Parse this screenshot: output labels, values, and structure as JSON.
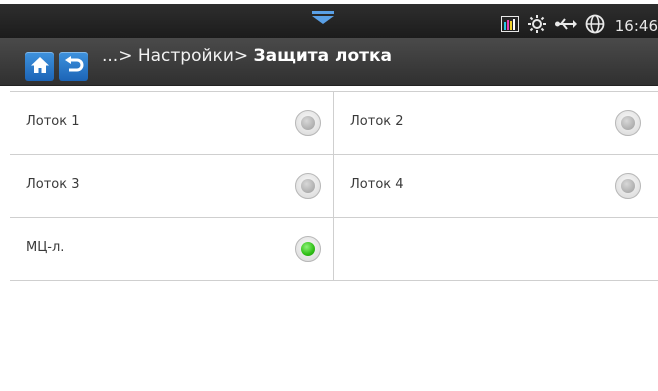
{
  "status_bar": {
    "time": "16:46",
    "icons": [
      "pull-down-icon",
      "toner-level-icon",
      "eco-mode-icon",
      "usb-icon",
      "network-icon"
    ]
  },
  "title_bar": {
    "breadcrumb_prefix": "...> Настройки> ",
    "current_page": "Защита лотка"
  },
  "trays": [
    {
      "label": "Лоток 1",
      "selected": false
    },
    {
      "label": "Лоток 2",
      "selected": false
    },
    {
      "label": "Лоток 3",
      "selected": false
    },
    {
      "label": "Лоток 4",
      "selected": false
    },
    {
      "label": "МЦ-л.",
      "selected": true
    }
  ],
  "colors": {
    "accent_button": "#1c64b6",
    "selected_indicator": "#2fbf15",
    "title_bar": "#3a3a3a"
  }
}
